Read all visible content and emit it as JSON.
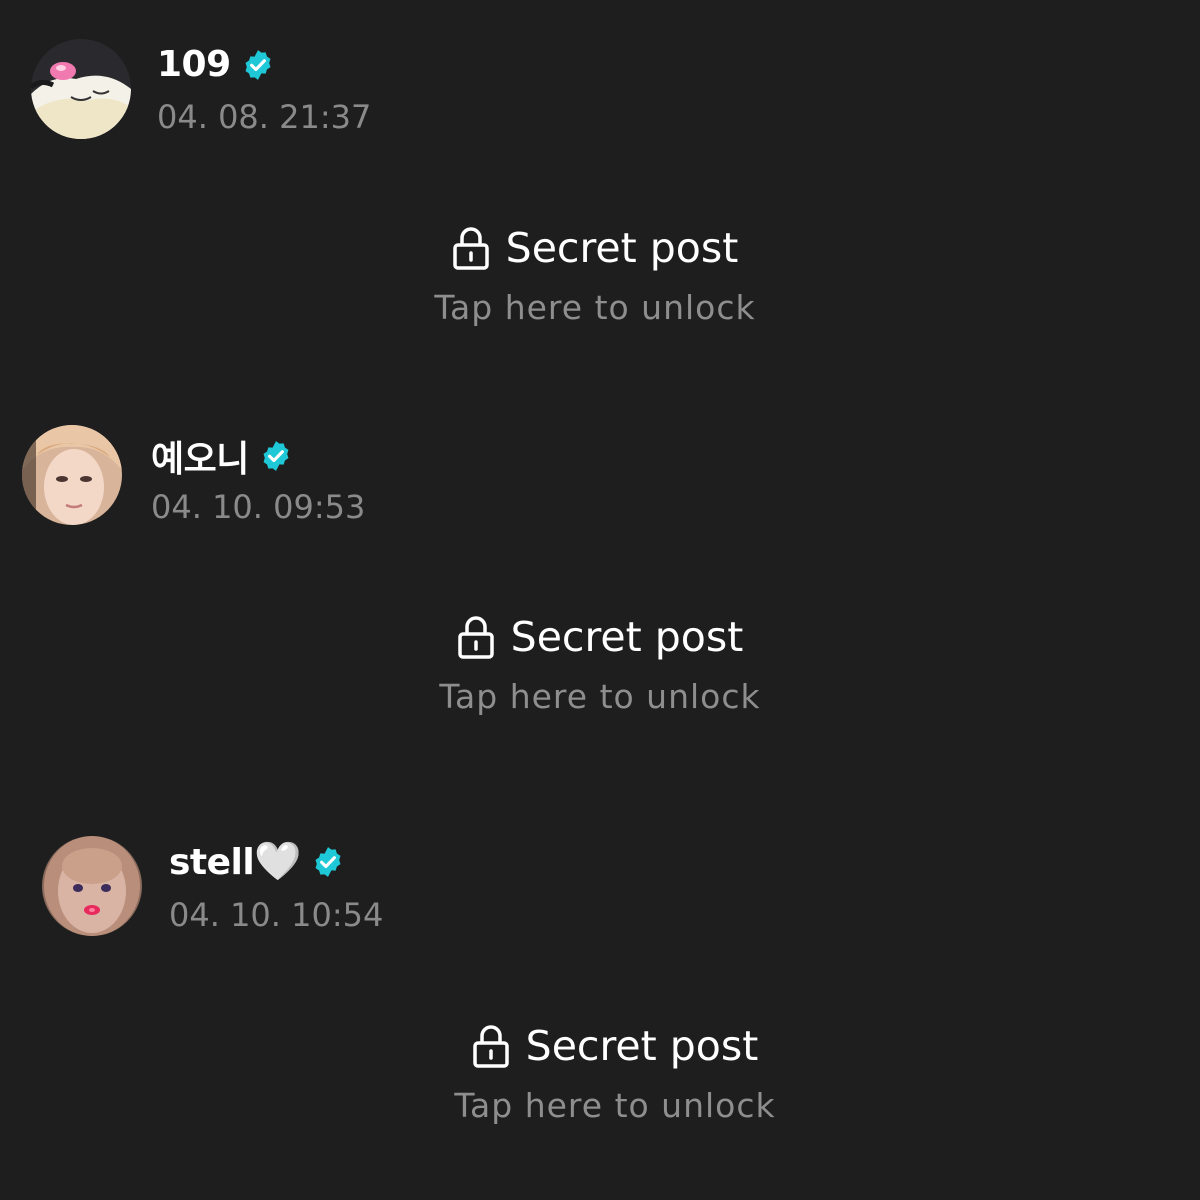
{
  "posts": [
    {
      "author": "109",
      "author_emoji": "",
      "timestamp": "04. 08. 21:37",
      "secret_title": "Secret post",
      "secret_subtitle": "Tap here to unlock"
    },
    {
      "author": "예오니",
      "author_emoji": "",
      "timestamp": "04. 10. 09:53",
      "secret_title": "Secret post",
      "secret_subtitle": "Tap here to unlock"
    },
    {
      "author": "stell",
      "author_emoji": "🤍",
      "timestamp": "04. 10. 10:54",
      "secret_title": "Secret post",
      "secret_subtitle": "Tap here to unlock"
    }
  ],
  "colors": {
    "background": "#1e1e1e",
    "verified_badge": "#1ec8d6",
    "text_primary": "#ffffff",
    "text_secondary": "#8a8a8a"
  },
  "icons": {
    "verified": "verified-badge-icon",
    "lock": "lock-icon"
  }
}
